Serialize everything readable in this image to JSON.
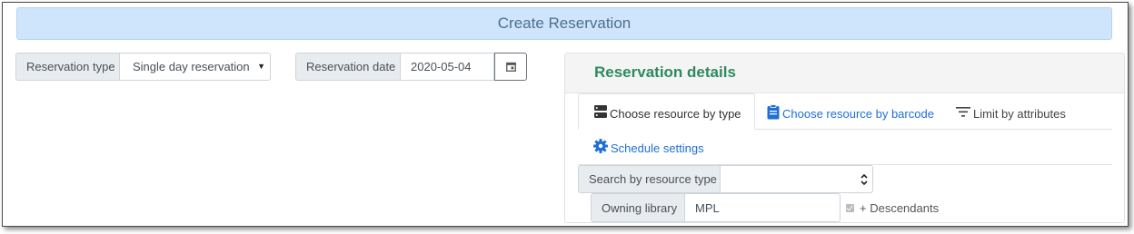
{
  "header": {
    "title": "Create Reservation"
  },
  "reservation_type": {
    "label": "Reservation type",
    "selected": "Single day reservation",
    "caret_icon": "caret-down-icon"
  },
  "reservation_date": {
    "label": "Reservation date",
    "value": "2020-05-04",
    "calendar_icon": "calendar-icon"
  },
  "details": {
    "title": "Reservation details",
    "tabs": [
      {
        "label": "Choose resource by type",
        "icon": "server-icon",
        "active": true
      },
      {
        "label": "Choose resource by barcode",
        "icon": "clipboard-icon",
        "active": false
      },
      {
        "label": "Limit by attributes",
        "icon": "filter-icon",
        "active": false
      },
      {
        "label": "Schedule settings",
        "icon": "gear-icon",
        "active": false
      }
    ],
    "search": {
      "label": "Search by resource type",
      "value": ""
    },
    "owning_library": {
      "label": "Owning library",
      "value": "MPL"
    },
    "descendants": {
      "label": "+ Descendants",
      "checked": true
    }
  },
  "colors": {
    "banner_bg": "#cfe5fb",
    "title_green": "#2e8a5e",
    "link_blue": "#1f6fd6"
  }
}
